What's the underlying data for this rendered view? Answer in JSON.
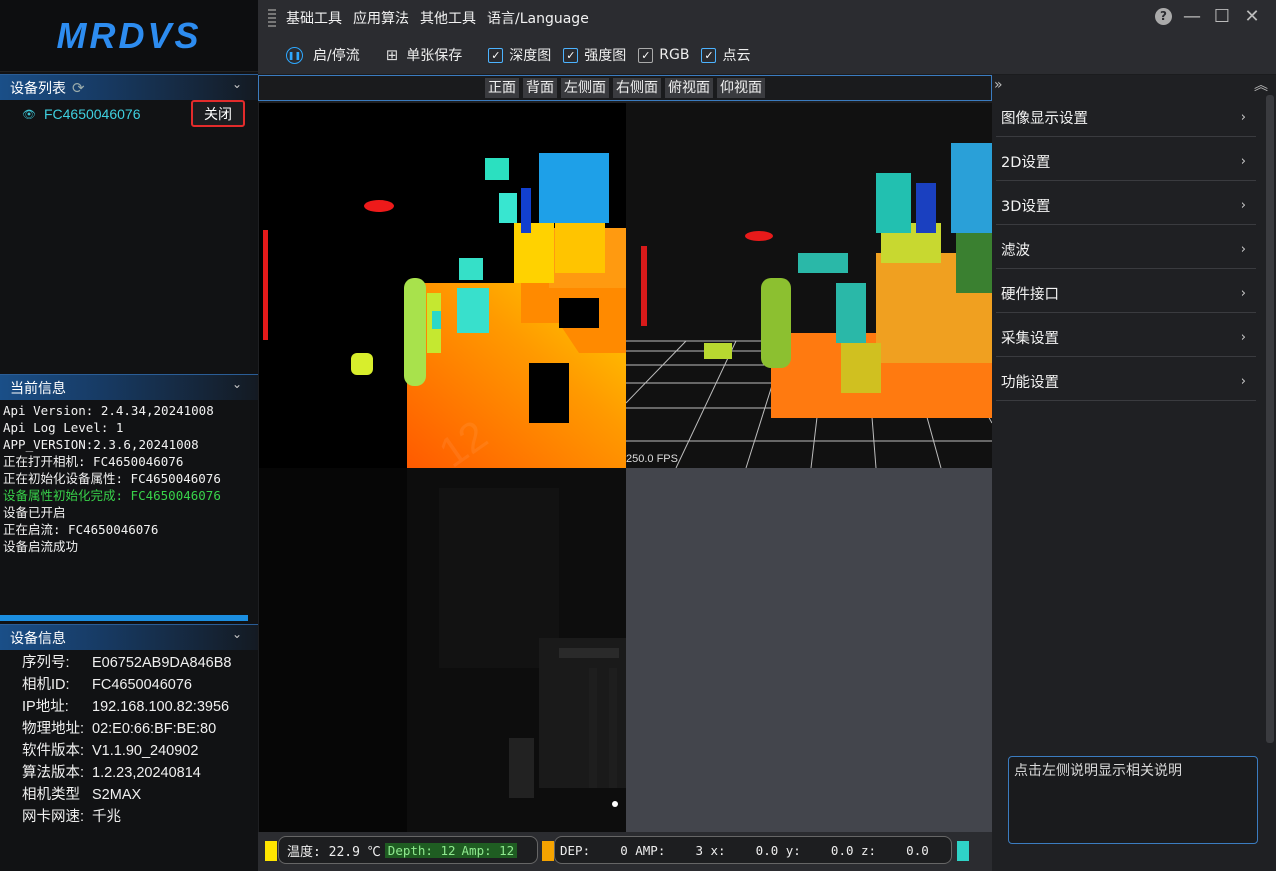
{
  "app": {
    "logo_text": "MRDVS"
  },
  "menu": [
    "基础工具",
    "应用算法",
    "其他工具",
    "语言/Language"
  ],
  "window_controls": {
    "help": "?",
    "minimize": "—",
    "maximize": "☐",
    "close": "✕"
  },
  "toolbar": {
    "start_stop": "启/停流",
    "save_single": "单张保存",
    "depth_map": "深度图",
    "intensity_map": "强度图",
    "rgb": "RGB",
    "point_cloud": "点云"
  },
  "view_buttons": [
    "正面",
    "背面",
    "左侧面",
    "右侧面",
    "俯视面",
    "仰视面"
  ],
  "device_list": {
    "title": "设备列表",
    "device_name": "FC4650046076",
    "close_label": "关闭"
  },
  "current_info": {
    "title": "当前信息",
    "log": [
      {
        "text": "Api Version: 2.4.34,20241008",
        "ok": false
      },
      {
        "text": "Api Log Level: 1",
        "ok": false
      },
      {
        "text": "APP_VERSION:2.3.6,20241008",
        "ok": false
      },
      {
        "text": "正在打开相机: FC4650046076",
        "ok": false
      },
      {
        "text": "正在初始化设备属性: FC4650046076",
        "ok": false
      },
      {
        "text": "设备属性初始化完成: FC4650046076",
        "ok": true
      },
      {
        "text": "设备已开启",
        "ok": false
      },
      {
        "text": "正在启流: FC4650046076",
        "ok": false
      },
      {
        "text": "设备启流成功",
        "ok": false
      }
    ]
  },
  "device_info": {
    "title": "设备信息",
    "rows": [
      {
        "k": "序列号:",
        "v": "E06752AB9DA846B8"
      },
      {
        "k": "相机ID:",
        "v": "FC4650046076"
      },
      {
        "k": "IP地址:",
        "v": "192.168.100.82:3956"
      },
      {
        "k": "物理地址:",
        "v": "02:E0:66:BF:BE:80"
      },
      {
        "k": "软件版本:",
        "v": "V1.1.90_240902"
      },
      {
        "k": "算法版本:",
        "v": "1.2.23,20240814"
      },
      {
        "k": "相机类型",
        "v": "S2MAX"
      },
      {
        "k": "网卡网速:",
        "v": "千兆"
      }
    ]
  },
  "viewer": {
    "fps_label": "250.0 FPS"
  },
  "status_bar": {
    "temperature_label": "温度: 22.9 ℃",
    "depth_label": "Depth: 12",
    "amp_label": "Amp: 12",
    "coords_text": "DEP:    0 AMP:    3 x:    0.0 y:    0.0 z:    0.0"
  },
  "settings": {
    "items": [
      "图像显示设置",
      "2D设置",
      "3D设置",
      "滤波",
      "硬件接口",
      "采集设置",
      "功能设置"
    ],
    "description_placeholder": "点击左侧说明显示相关说明"
  },
  "colors": {
    "accent": "#2d8cf0",
    "highlight_border": "#e32b2b",
    "ok_text": "#38d24a",
    "device_name": "#3fd0e0",
    "status_yellow": "#ffe600",
    "status_orange": "#f5a300",
    "status_cyan": "#2fd3c7"
  }
}
